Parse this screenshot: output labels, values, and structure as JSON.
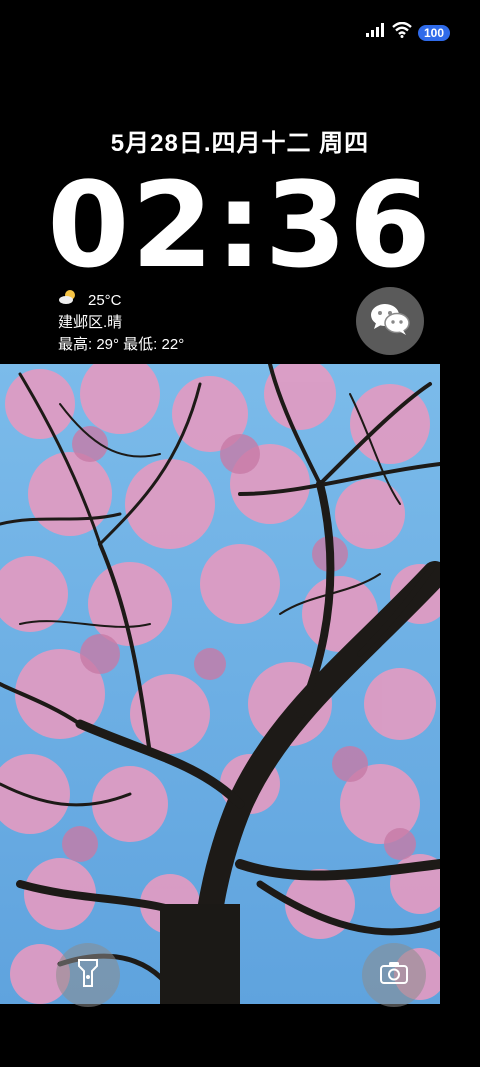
{
  "status": {
    "battery": "100",
    "icons": [
      "signal-icon",
      "wifi-icon",
      "battery-icon"
    ]
  },
  "lockscreen": {
    "date": "5月28日.四月十二 周四",
    "time": "02:36"
  },
  "weather": {
    "temp": "25°C",
    "location": "建邺区.晴",
    "range": "最高: 29° 最低: 22°",
    "icon": "partly-cloudy-icon"
  },
  "shortcuts": {
    "wechat": "wechat-icon",
    "flashlight": "flashlight-icon",
    "camera": "camera-icon"
  },
  "colors": {
    "battery_accent": "#2f6bea",
    "sky": "#6fb0e8",
    "blossom": "#e49ac0"
  }
}
